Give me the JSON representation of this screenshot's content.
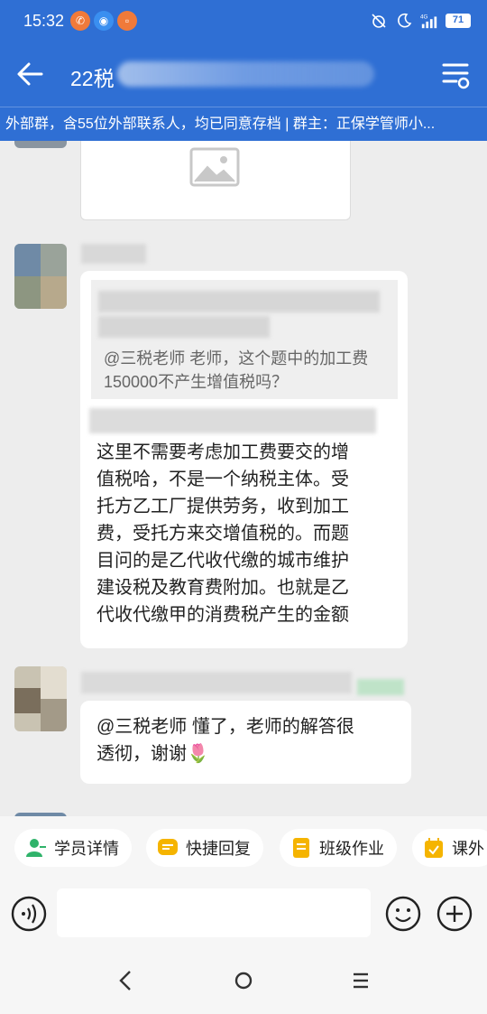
{
  "status_bar": {
    "time": "15:32",
    "battery": "71",
    "network": "4G"
  },
  "header": {
    "title": "22税",
    "back_icon": "arrow-left-icon",
    "menu_icon": "chat-settings-icon"
  },
  "notice": {
    "text": "外部群，含55位外部联系人，均已同意存档 | 群主：正保学管师小..."
  },
  "messages": {
    "quote_text": "@三税老师 老师，这个题中的加工费150000不产生增值税吗？",
    "reply_lines": [
      "这里不需要考虑加工费要交的增",
      "值税哈，不是一个纳税主体。受",
      "托方乙工厂提供劳务，收到加工",
      "费，受托方来交增值税的。而题",
      "目问的是乙代收代缴的城市维护",
      "建设税及教育费附加。也就是乙",
      "代收代缴甲的消费税产生的金额"
    ],
    "thanks_lines": [
      "@三税老师 懂了，老师的解答很",
      "透彻，谢谢🌷"
    ]
  },
  "toolbar": {
    "chips": [
      {
        "label": "学员详情",
        "icon": "student-icon",
        "color": "#2fb36a"
      },
      {
        "label": "快捷回复",
        "icon": "quick-reply-icon",
        "color": "#f5b400"
      },
      {
        "label": "班级作业",
        "icon": "homework-icon",
        "color": "#f5b400"
      },
      {
        "label": "课外",
        "icon": "calendar-icon",
        "color": "#f5b400"
      }
    ]
  },
  "input": {
    "placeholder": ""
  },
  "colors": {
    "brand_blue": "#2f6fd4",
    "background": "#ededed"
  }
}
